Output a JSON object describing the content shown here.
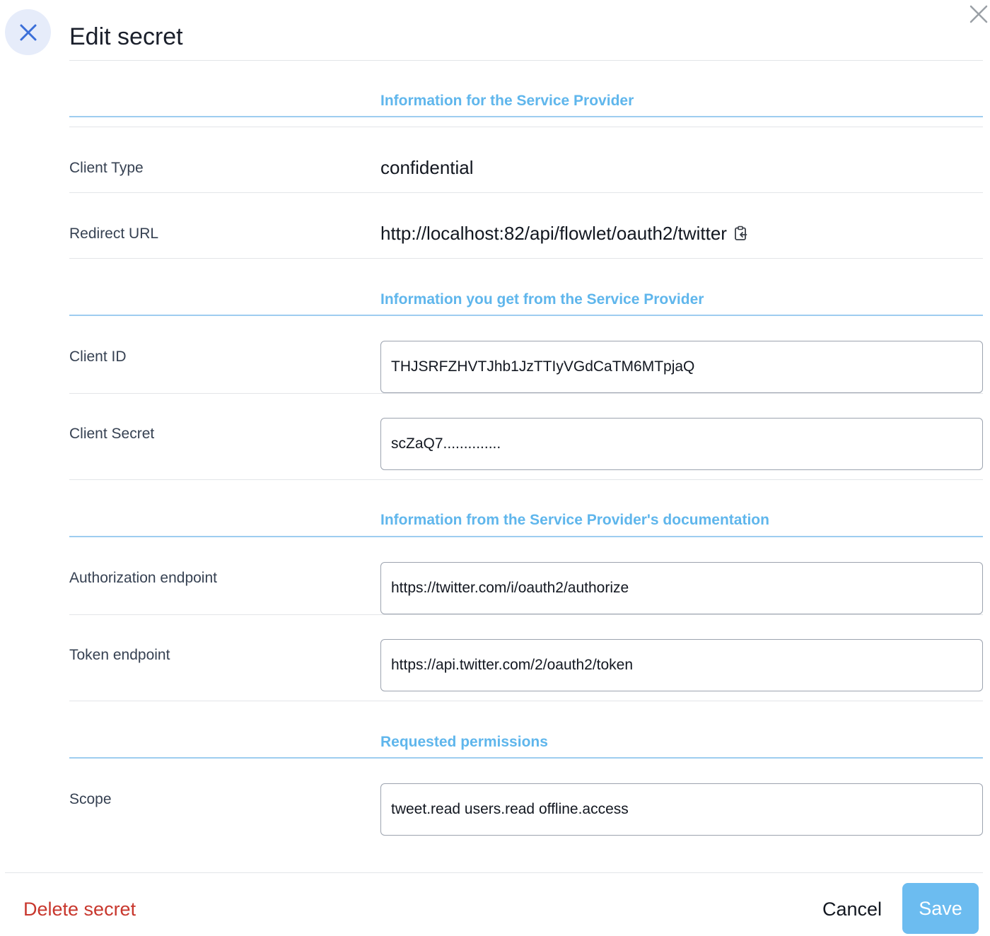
{
  "dialog": {
    "title": "Edit secret"
  },
  "sections": [
    {
      "title": "Information for the Service Provider"
    },
    {
      "title": "Information you get from the Service Provider"
    },
    {
      "title": "Information from the Service Provider's documentation"
    },
    {
      "title": "Requested permissions"
    }
  ],
  "fields": {
    "client_type": {
      "label": "Client Type",
      "value": "confidential"
    },
    "redirect_url": {
      "label": "Redirect URL",
      "value": "http://localhost:82/api/flowlet/oauth2/twitter"
    },
    "client_id": {
      "label": "Client ID",
      "value": "THJSRFZHVTJhb1JzTTIyVGdCaTM6MTpjaQ"
    },
    "client_secret": {
      "label": "Client Secret",
      "value": "scZaQ7.............."
    },
    "authorization_endpoint": {
      "label": "Authorization endpoint",
      "value": "https://twitter.com/i/oauth2/authorize"
    },
    "token_endpoint": {
      "label": "Token endpoint",
      "value": "https://api.twitter.com/2/oauth2/token"
    },
    "scope": {
      "label": "Scope",
      "value": "tweet.read users.read offline.access"
    }
  },
  "footer": {
    "delete_label": "Delete secret",
    "cancel_label": "Cancel",
    "save_label": "Save"
  },
  "colors": {
    "accent": "#5fb6ec",
    "save_button": "#6cbcf0",
    "danger": "#c8372d",
    "badge_bg": "#e6ecfa",
    "badge_icon": "#3b6fd9"
  },
  "icons": {
    "badge": "close-icon",
    "corner": "close-icon",
    "redirect_copy": "clipboard-copy-icon"
  }
}
